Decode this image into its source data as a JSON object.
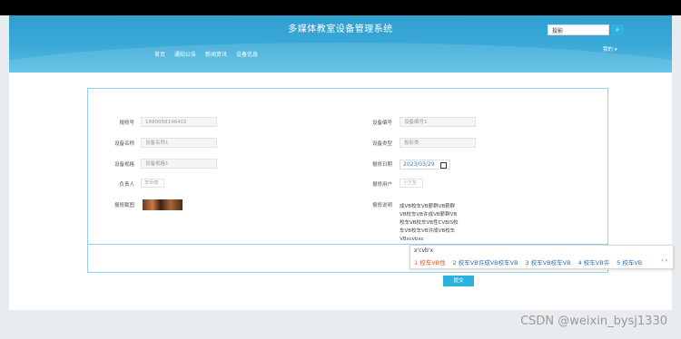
{
  "header": {
    "title": "多媒体教室设备管理系统",
    "nav": [
      "首页",
      "通知公告",
      "新闻资讯",
      "设备信息"
    ],
    "search_value": "投影",
    "user_menu": "我的 ▾"
  },
  "form": {
    "left": [
      {
        "label": "报修号",
        "value": "1680058146402"
      },
      {
        "label": "设备名称",
        "value": "设备名称1"
      },
      {
        "label": "设备规格",
        "value": "设备规格1"
      },
      {
        "label": "负责人",
        "value": "李师傅"
      },
      {
        "label": "报修截图",
        "value": ""
      }
    ],
    "right": [
      {
        "label": "设备编号",
        "value": "设备编号1"
      },
      {
        "label": "设备类型",
        "value": "投影类"
      },
      {
        "label": "报修日期",
        "value": "2023/03/29"
      },
      {
        "label": "报修用户",
        "value": "小王友"
      },
      {
        "label": "报修说明",
        "value": ""
      }
    ],
    "description_lines": [
      "成VB校车VB薪群VB薪群",
      "VB校车VB许成VB薪群VB",
      "校车VB校车VB性CVBIS校",
      "车VB校车VB许成VB校车",
      "VBxcvbxc"
    ],
    "submit_label": "提交"
  },
  "ime": {
    "typed": "x'cvb'x",
    "candidates": [
      "1 校车VB性",
      "2 校车VB许成VB校车VB",
      "3 校车VB校车VB",
      "4 校车VB许",
      "5 校车VB"
    ],
    "arrows": "‹  ›"
  },
  "watermark": "CSDN @weixin_bysj1330"
}
